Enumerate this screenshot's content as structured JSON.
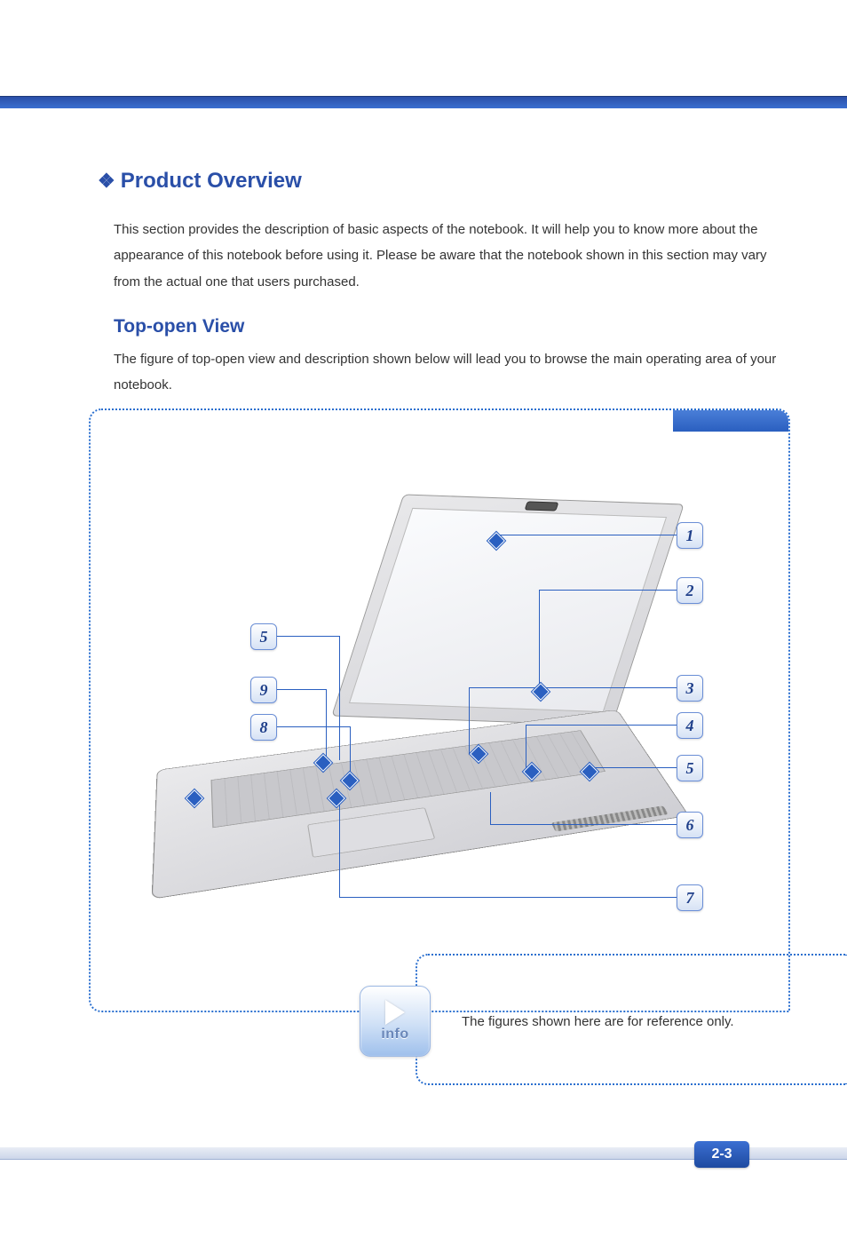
{
  "heading": "Product Overview",
  "intro": "This section provides the description of basic aspects of the notebook.   It will help you to know more about the appearance of this notebook before using it. Please be aware that the notebook shown in this section may vary from the actual one that users purchased.",
  "subheading": "Top-open View",
  "subtext": "The figure of top-open view and description shown below will lead you to browse the main operating area of your notebook.",
  "callouts": {
    "n1": "1",
    "n2": "2",
    "n3": "3",
    "n4": "4",
    "n5": "5",
    "n6": "6",
    "n7": "7",
    "n8": "8",
    "n9": "9"
  },
  "info_label": "info",
  "info_text": "The figures shown here are for reference only.",
  "page_number": "2-3"
}
